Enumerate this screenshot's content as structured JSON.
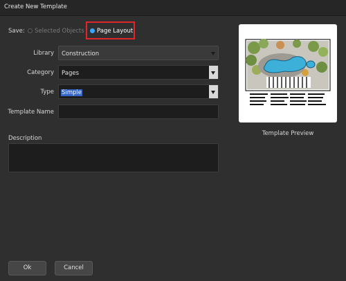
{
  "window": {
    "title": "Create New Template"
  },
  "save": {
    "label": "Save:",
    "options": [
      "Selected Objects",
      "Page Layout"
    ],
    "selected": "Page Layout"
  },
  "form": {
    "library": {
      "label": "Library",
      "value": "Construction"
    },
    "category": {
      "label": "Category",
      "value": "Pages"
    },
    "type": {
      "label": "Type",
      "value": "Simple"
    },
    "template_name": {
      "label": "Template Name",
      "value": ""
    },
    "description": {
      "label": "Description",
      "value": ""
    }
  },
  "preview": {
    "caption": "Template Preview"
  },
  "buttons": {
    "ok": "Ok",
    "cancel": "Cancel"
  },
  "colors": {
    "background": "#2f2f2f",
    "accent": "#3aa7ff",
    "highlight": "#e0262a",
    "selection": "#3565c6"
  }
}
